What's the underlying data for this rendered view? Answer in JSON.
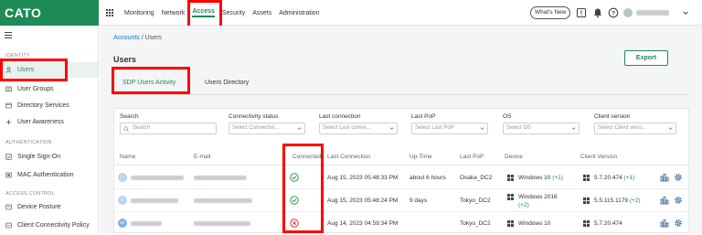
{
  "brand": "CATO",
  "topnav": [
    {
      "label": "Monitoring"
    },
    {
      "label": "Network"
    },
    {
      "label": "Access",
      "active": true
    },
    {
      "label": "Security"
    },
    {
      "label": "Assets"
    },
    {
      "label": "Administration"
    }
  ],
  "whats_new": "What's New",
  "sidebar": {
    "section_identity": "IDENTITY",
    "items_identity": [
      {
        "label": "Users",
        "icon": "person-icon",
        "active": true
      },
      {
        "label": "User Groups",
        "icon": "group-icon"
      },
      {
        "label": "Directory Services",
        "icon": "directory-icon"
      },
      {
        "label": "User Awareness",
        "icon": "plus-icon"
      }
    ],
    "section_auth": "AUTHENTICATION",
    "items_auth": [
      {
        "label": "Single Sign-On",
        "icon": "check-square-icon"
      },
      {
        "label": "MAC Authentication",
        "icon": "mac-icon"
      }
    ],
    "section_access": "ACCESS CONTROL",
    "items_access": [
      {
        "label": "Device Posture",
        "icon": "device-icon"
      },
      {
        "label": "Client Connectivity Policy",
        "icon": "policy-icon"
      }
    ]
  },
  "breadcrumb": {
    "root": "Accounts",
    "sep": "/",
    "current": "Users"
  },
  "page_title": "Users",
  "export_label": "Export",
  "tabs": [
    {
      "label": "SDP Users Activity",
      "active": true
    },
    {
      "label": "Users Directory"
    }
  ],
  "filters": {
    "search": {
      "label": "Search",
      "placeholder": "Search"
    },
    "connectivity": {
      "label": "Connectivity status",
      "placeholder": "Select Connectivi..."
    },
    "last_connection": {
      "label": "Last connection",
      "placeholder": "Select Last conne..."
    },
    "last_pop": {
      "label": "Last PoP",
      "placeholder": "Select Last PoP"
    },
    "os": {
      "label": "OS",
      "placeholder": "Select OS"
    },
    "client_version": {
      "label": "Client version",
      "placeholder": "Select Client versi..."
    }
  },
  "columns": [
    "Name",
    "E-mail",
    "Connected",
    "Last Connection",
    "Up-Time",
    "Last PoP",
    "Device",
    "Client Version"
  ],
  "rows": [
    {
      "avatar": "TT",
      "connected": true,
      "last_connection": "Aug 15, 2023 05:48:33 PM",
      "uptime": "about 6 hours",
      "last_pop": "Osaka_DC2",
      "device": "Windows 10",
      "device_extra": "(+1)",
      "client_version": "5.7.20.474",
      "client_extra": "(+1)"
    },
    {
      "avatar": "TT",
      "connected": true,
      "last_connection": "Aug 15, 2023 05:48:24 PM",
      "uptime": "9 days",
      "last_pop": "Tokyo_DC2",
      "device": "Windows 2016",
      "device_extra": "(+2)",
      "client_version": "5.5.115.1179",
      "client_extra": "(+2)"
    },
    {
      "avatar": "BP",
      "connected": false,
      "last_connection": "Aug 14, 2023 04:59:34 PM",
      "uptime": "",
      "last_pop": "Tokyo_DC2",
      "device": "Windows 10",
      "device_extra": "",
      "client_version": "5.7.20.474",
      "client_extra": ""
    }
  ],
  "colors": {
    "brand_green": "#1e8a56",
    "highlight_red": "#ff0000",
    "success": "#2e9b4b",
    "error": "#d93535"
  }
}
